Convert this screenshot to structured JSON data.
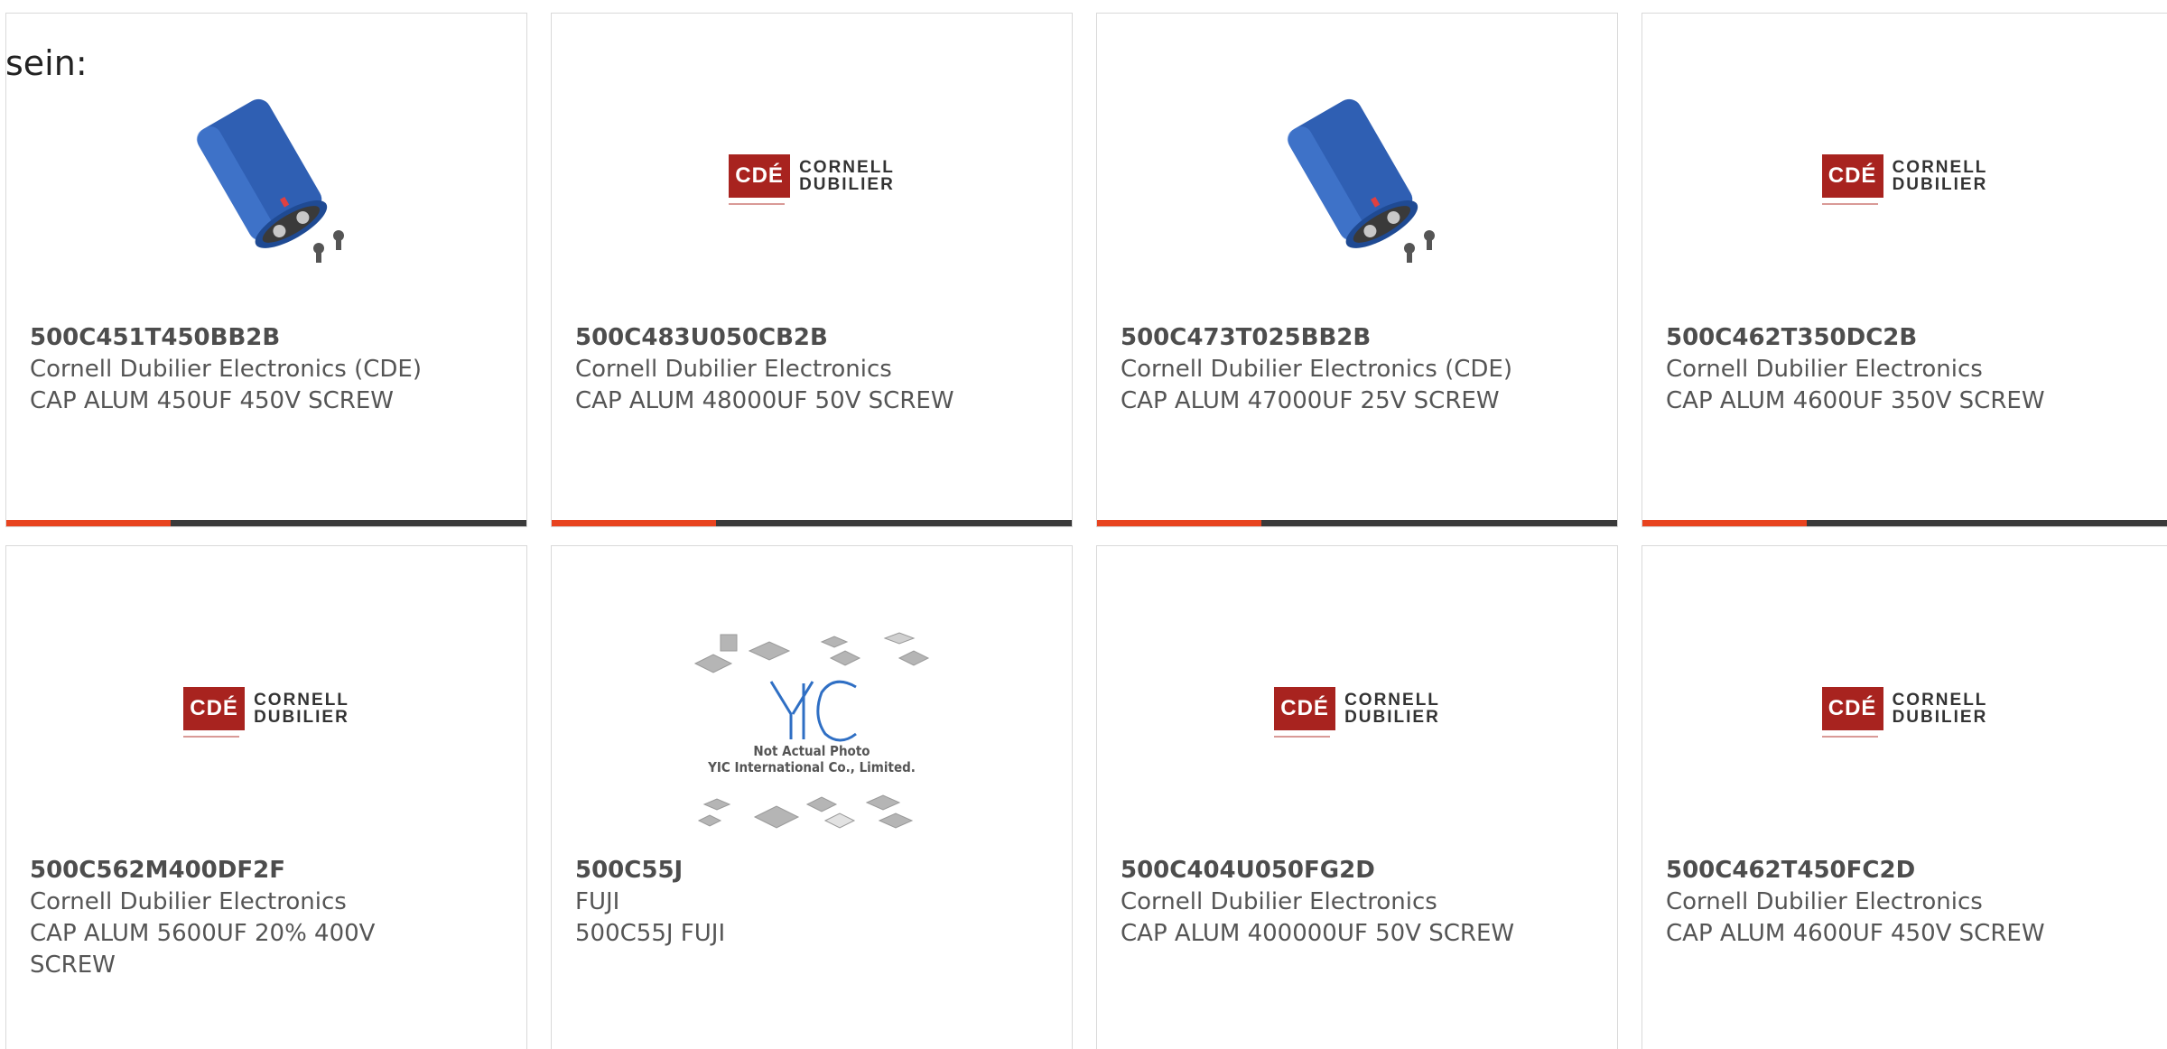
{
  "intro": "sein:",
  "cards": [
    {
      "part": "500C451T450BB2B",
      "manufacturer": "Cornell Dubilier Electronics (CDE)",
      "description": "CAP ALUM 450UF 450V SCREW",
      "image": "capacitor-photo"
    },
    {
      "part": "500C483U050CB2B",
      "manufacturer": "Cornell Dubilier Electronics",
      "description": "CAP ALUM 48000UF 50V SCREW",
      "image": "cde-logo"
    },
    {
      "part": "500C473T025BB2B",
      "manufacturer": "Cornell Dubilier Electronics (CDE)",
      "description": "CAP ALUM 47000UF 25V SCREW",
      "image": "capacitor-photo"
    },
    {
      "part": "500C462T350DC2B",
      "manufacturer": "Cornell Dubilier Electronics",
      "description": "CAP ALUM 4600UF 350V SCREW",
      "image": "cde-logo"
    },
    {
      "part": "500C562M400DF2F",
      "manufacturer": "Cornell Dubilier Electronics",
      "description": "CAP ALUM 5600UF 20% 400V SCREW",
      "image": "cde-logo"
    },
    {
      "part": "500C55J",
      "manufacturer": "FUJI",
      "description": "500C55J FUJI",
      "image": "yic-placeholder"
    },
    {
      "part": "500C404U050FG2D",
      "manufacturer": "Cornell Dubilier Electronics",
      "description": "CAP ALUM 400000UF 50V SCREW",
      "image": "cde-logo"
    },
    {
      "part": "500C462T450FC2D",
      "manufacturer": "Cornell Dubilier Electronics",
      "description": "CAP ALUM 4600UF 450V SCREW",
      "image": "cde-logo"
    }
  ],
  "logo": {
    "box": "CDÉ",
    "line1": "CORNELL",
    "line2": "DUBILIER"
  },
  "yic": {
    "line1": "Not Actual Photo",
    "line2": "YIC International Co., Limited."
  },
  "colors": {
    "accent": "#e8431f",
    "bar": "#3a3a3a",
    "capacitor": "#2f5fb3",
    "logo_red": "#a8231f"
  }
}
